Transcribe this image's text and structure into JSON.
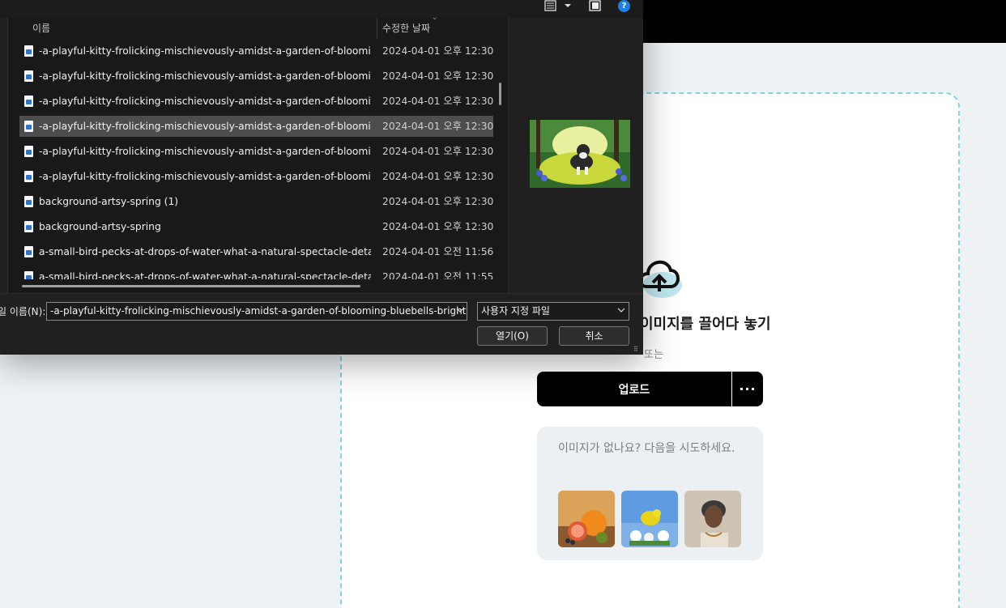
{
  "background": {
    "drag_title": "이미지를 끌어다 놓기",
    "or_text": "또는",
    "upload_label": "업로드",
    "more_label": "···",
    "samples_text": "이미지가 없나요? 다음을 시도하세요.",
    "colors": {
      "accent_border": "#7ed6de",
      "button": "#000000"
    }
  },
  "dialog": {
    "toolbar_icons": [
      "view-list-icon",
      "chevron-down-icon",
      "preview-pane-icon",
      "help-icon"
    ],
    "help_label": "?",
    "col_name": "이름",
    "col_modified": "수정한 날짜",
    "files": [
      {
        "name": "-a-playful-kitty-frolicking-mischievously-amidst-a-garden-of-blooming-bl...",
        "date": "2024-04-01 오후 12:30"
      },
      {
        "name": "-a-playful-kitty-frolicking-mischievously-amidst-a-garden-of-blooming-bl...",
        "date": "2024-04-01 오후 12:30"
      },
      {
        "name": "-a-playful-kitty-frolicking-mischievously-amidst-a-garden-of-blooming-bl...",
        "date": "2024-04-01 오후 12:30"
      },
      {
        "name": "-a-playful-kitty-frolicking-mischievously-amidst-a-garden-of-blooming-bl...",
        "date": "2024-04-01 오후 12:30"
      },
      {
        "name": "-a-playful-kitty-frolicking-mischievously-amidst-a-garden-of-blooming-bl...",
        "date": "2024-04-01 오후 12:30"
      },
      {
        "name": "-a-playful-kitty-frolicking-mischievously-amidst-a-garden-of-blooming-bl...",
        "date": "2024-04-01 오후 12:30"
      },
      {
        "name": "background-artsy-spring (1)",
        "date": "2024-04-01 오후 12:30"
      },
      {
        "name": "background-artsy-spring",
        "date": "2024-04-01 오후 12:30"
      },
      {
        "name": "a-small-bird-pecks-at-drops-of-water-what-a-natural-spectacle-detailed-c...",
        "date": "2024-04-01 오전 11:56"
      },
      {
        "name": "a-small-bird-pecks-at-drops-of-water-what-a-natural-spectacle-detailed-c...",
        "date": "2024-04-01 오전 11:55"
      }
    ],
    "filename_label": "파일 이름(N):",
    "filename_value": "-a-playful-kitty-frolicking-mischievously-amidst-a-garden-of-blooming-bluebells-bright-green",
    "filetype_value": "사용자 지정 파일",
    "open_label": "열기(O)",
    "cancel_label": "취소"
  }
}
